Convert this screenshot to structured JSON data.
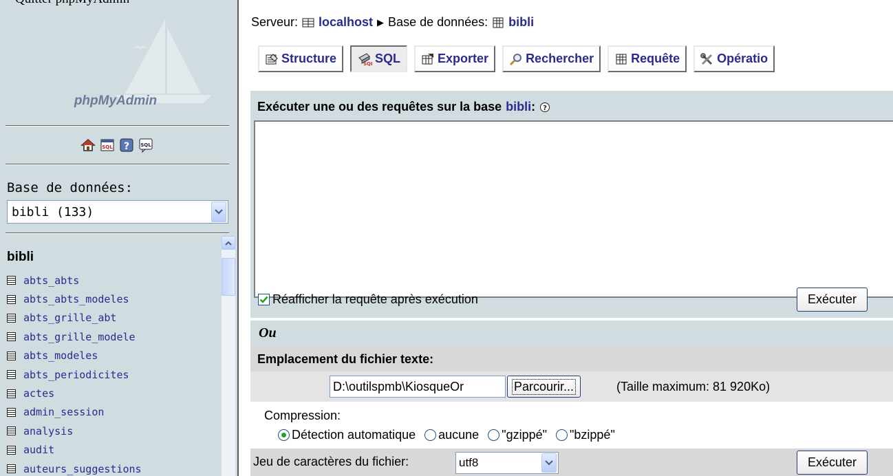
{
  "left": {
    "quit_text": "Quitter phpMyAdmin",
    "logo_text": "phpMyAdmin",
    "icons": [
      "home-icon",
      "sql-query-icon",
      "help-icon",
      "sql-docs-icon"
    ],
    "db_label": "Base de données:",
    "db_select_value": "bibli (133)",
    "table_heading": "bibli",
    "tables": [
      "abts_abts",
      "abts_abts_modeles",
      "abts_grille_abt",
      "abts_grille_modele",
      "abts_modeles",
      "abts_periodicites",
      "actes",
      "admin_session",
      "analysis",
      "audit",
      "auteurs_suggestions"
    ]
  },
  "breadcrumb": {
    "server_label": "Serveur:",
    "server_name": "localhost",
    "db_label": "Base de données:",
    "db_name": "bibli"
  },
  "tabs": [
    {
      "label": "Structure",
      "icon": "structure-icon",
      "active": false
    },
    {
      "label": "SQL",
      "icon": "sql-icon",
      "active": true
    },
    {
      "label": "Exporter",
      "icon": "export-icon",
      "active": false
    },
    {
      "label": "Rechercher",
      "icon": "search-icon",
      "active": false
    },
    {
      "label": "Requête",
      "icon": "query-icon",
      "active": false
    },
    {
      "label": "Opératio",
      "icon": "operations-icon",
      "active": false
    }
  ],
  "sql": {
    "heading_prefix": "Exécuter une ou des requêtes sur la base",
    "heading_db": "bibli",
    "heading_suffix": ":",
    "query_text": "",
    "reshow_label": "Réafficher la requête après exécution",
    "reshow_checked": true,
    "execute_label": "Exécuter"
  },
  "import": {
    "or_label": "Ou",
    "file_label": "Emplacement du fichier texte:",
    "file_value": "D:\\outilspmb\\KiosqueOr",
    "browse_label": "Parcourir...",
    "max_size": "(Taille maximum: 81 920Ko)",
    "compression_label": "Compression:",
    "compression_options": [
      {
        "label": "Détection automatique",
        "selected": true
      },
      {
        "label": "aucune",
        "selected": false
      },
      {
        "label": "\"gzippé\"",
        "selected": false
      },
      {
        "label": "\"bzippé\"",
        "selected": false
      }
    ],
    "charset_label": "Jeu de caractères du fichier:",
    "charset_value": "utf8",
    "execute_label": "Exécuter"
  },
  "colors": {
    "panel_bg": "#d0dce0",
    "link": "#2a2a90",
    "accent_check": "#21a121"
  }
}
